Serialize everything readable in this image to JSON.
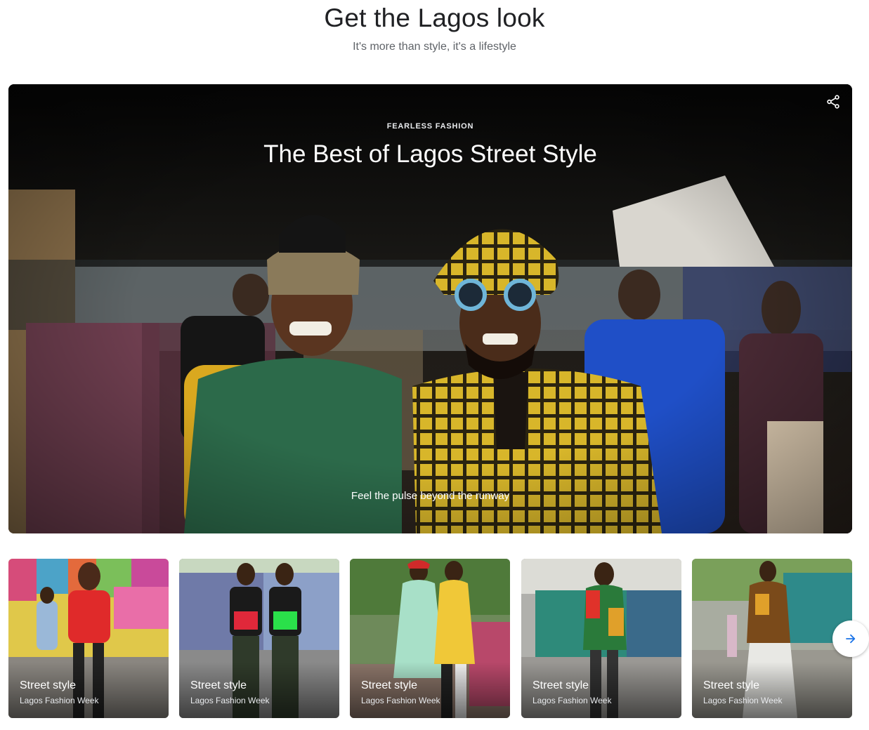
{
  "header": {
    "title": "Get the Lagos look",
    "subtitle": "It's more than style, it's a lifestyle"
  },
  "hero": {
    "overline": "FEARLESS FASHION",
    "title": "The Best of Lagos Street Style",
    "caption": "Feel the pulse beyond the runway",
    "share_icon": "share-icon"
  },
  "cards": [
    {
      "title": "Street style",
      "subtitle": "Lagos Fashion Week"
    },
    {
      "title": "Street style",
      "subtitle": "Lagos Fashion Week"
    },
    {
      "title": "Street style",
      "subtitle": "Lagos Fashion Week"
    },
    {
      "title": "Street style",
      "subtitle": "Lagos Fashion Week"
    },
    {
      "title": "Street style",
      "subtitle": "Lagos Fashion Week"
    }
  ],
  "carousel": {
    "next_icon": "arrow-right-icon"
  },
  "colors": {
    "accent": "#1a73e8",
    "title_text": "#202124",
    "subtitle_text": "#5f6368"
  }
}
